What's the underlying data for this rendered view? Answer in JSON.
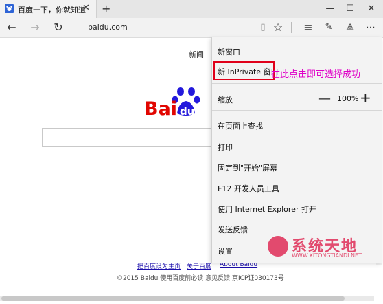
{
  "tab": {
    "title": "百度一下，你就知道",
    "close": "✕",
    "new_tab": "+"
  },
  "window_buttons": {
    "minimize": "—",
    "maximize": "☐",
    "close": "✕"
  },
  "address": {
    "url": "baidu.com"
  },
  "page": {
    "top_link": "新闻",
    "logo": {
      "left": "Bai",
      "right": "du"
    },
    "footer_links": [
      "把百度设为主页",
      "关于百度",
      "About  Baidu"
    ],
    "copyright_prefix": "©2015 Baidu",
    "copyright_link1": "使用百度前必读",
    "copyright_link2": "意见反馈",
    "copyright_icp": "京ICP证030173号"
  },
  "menu": {
    "items": {
      "new_window": "新窗口",
      "new_inprivate": "新 InPrivate 窗口",
      "zoom": "缩放",
      "find": "在页面上查找",
      "print": "打印",
      "pin_start": "固定到\"开始\"屏幕",
      "dev_tools": "F12 开发人员工具",
      "open_ie": "使用 Internet Explorer 打开",
      "feedback": "发送反馈",
      "settings": "设置"
    },
    "zoom_value": "100%",
    "zoom_minus": "—",
    "zoom_plus": "+"
  },
  "annotation": "在此点击即可选择成功",
  "watermark": {
    "text": "系统天地",
    "sub": "WWW.XITONGTIANDI.NET"
  },
  "colors": {
    "highlight": "#e0001a",
    "annotation": "#e000c8",
    "baidu_red": "#e10601",
    "baidu_blue": "#2319dc"
  }
}
